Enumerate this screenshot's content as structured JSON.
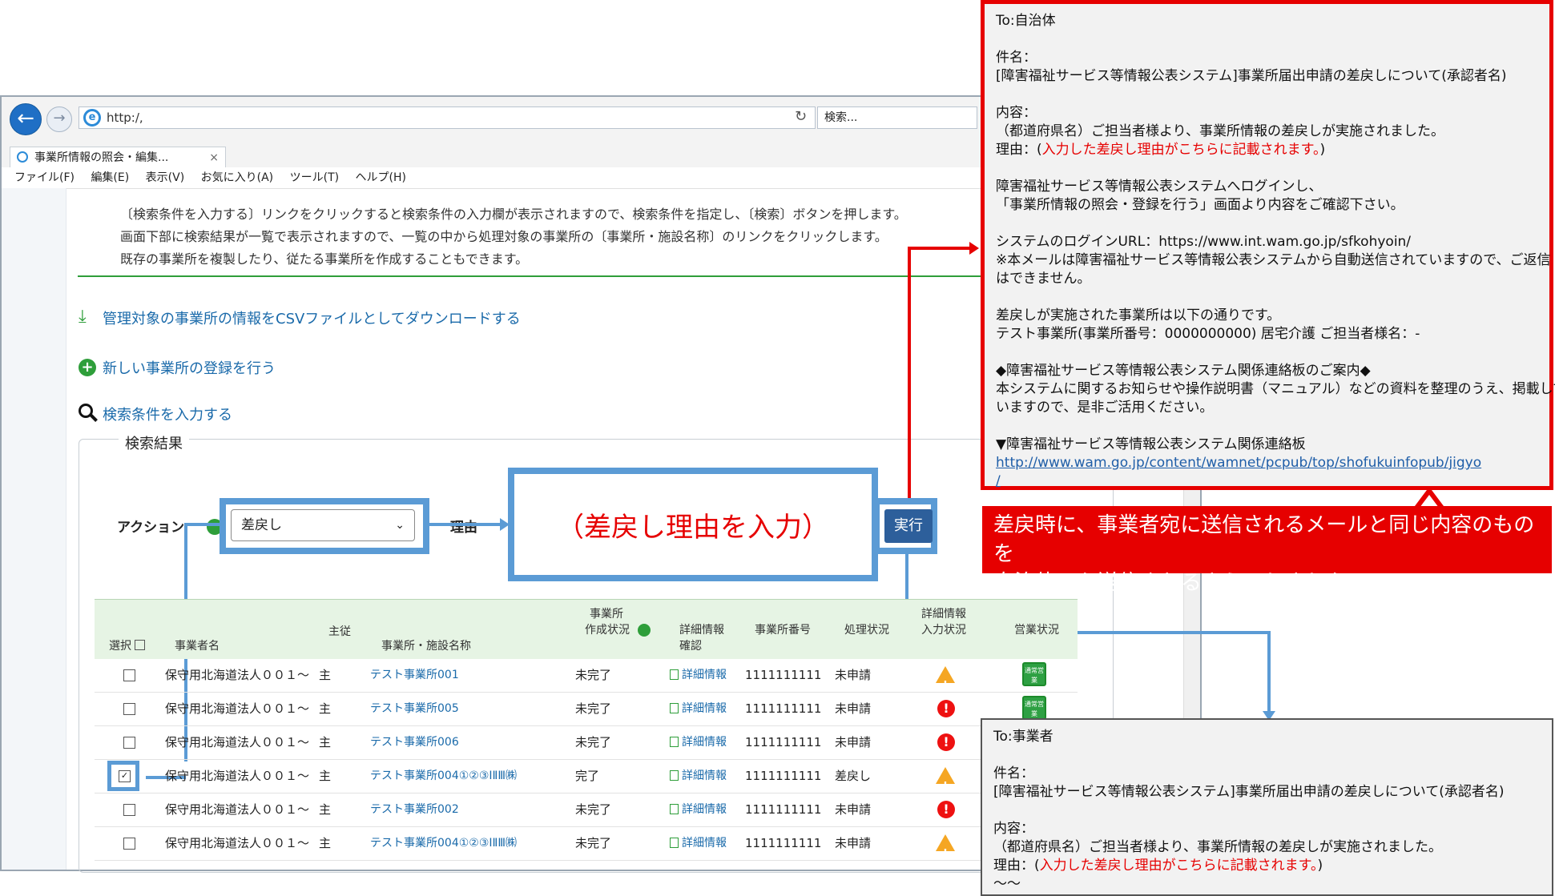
{
  "browser": {
    "url": "http:/,",
    "search_placeholder": "検索...",
    "tab_title": "事業所情報の照会・編集...",
    "tab_close": "×",
    "menu": [
      "ファイル(F)",
      "編集(E)",
      "表示(V)",
      "お気に入り(A)",
      "ツール(T)",
      "ヘルプ(H)"
    ]
  },
  "intro": [
    "〔検索条件を入力する〕リンクをクリックすると検索条件の入力欄が表示されますので、検索条件を指定し、〔検索〕ボタンを押します。",
    "画面下部に検索結果が一覧で表示されますので、一覧の中から処理対象の事業所の〔事業所・施設名称〕のリンクをクリックします。",
    "既存の事業所を複製したり、従たる事業所を作成することもできます。"
  ],
  "links": {
    "csv": "管理対象の事業所の情報をCSVファイルとしてダウンロードする",
    "new": "新しい事業所の登録を行う",
    "search": "検索条件を入力する"
  },
  "results": {
    "legend": "検索結果",
    "action_label": "アクション",
    "action_value": "差戻し",
    "reason_label": "理由",
    "reason_box": "（差戻し理由を入力）",
    "exec": "実行"
  },
  "table": {
    "headers": {
      "select": "選択",
      "name": "事業者名",
      "main": "主従",
      "facility": "事業所・施設名称",
      "create_status_1": "事業所",
      "create_status_2": "作成状況",
      "detail_1": "詳細情報",
      "detail_2": "確認",
      "number": "事業所番号",
      "process": "処理状況",
      "detail_input_1": "詳細情報",
      "detail_input_2": "入力状況",
      "business": "営業状況"
    },
    "rows": [
      {
        "checked": false,
        "name": "保守用北海道法人００１～",
        "main": "主",
        "facility": "テスト事業所001",
        "create": "未完了",
        "detail": "詳細情報",
        "number": "1111111111",
        "process": "未申請",
        "input_status": "warning",
        "business": "通常営業"
      },
      {
        "checked": false,
        "name": "保守用北海道法人００１～",
        "main": "主",
        "facility": "テスト事業所005",
        "create": "未完了",
        "detail": "詳細情報",
        "number": "1111111111",
        "process": "未申請",
        "input_status": "error",
        "business": "通常営業"
      },
      {
        "checked": false,
        "name": "保守用北海道法人００１～",
        "main": "主",
        "facility": "テスト事業所006",
        "create": "未完了",
        "detail": "詳細情報",
        "number": "1111111111",
        "process": "未申請",
        "input_status": "error",
        "business": ""
      },
      {
        "checked": true,
        "name": "保守用北海道法人００１～",
        "main": "主",
        "facility": "テスト事業所004①②③ⅠⅡⅢ㈱",
        "create": "完了",
        "detail": "詳細情報",
        "number": "1111111111",
        "process": "差戻し",
        "input_status": "warning",
        "business": ""
      },
      {
        "checked": false,
        "name": "保守用北海道法人００１～",
        "main": "主",
        "facility": "テスト事業所002",
        "create": "未完了",
        "detail": "詳細情報",
        "number": "1111111111",
        "process": "未申請",
        "input_status": "error",
        "business": ""
      },
      {
        "checked": false,
        "name": "保守用北海道法人００１～",
        "main": "主",
        "facility": "テスト事業所004①②③ⅠⅡⅢ㈱",
        "create": "未完了",
        "detail": "詳細情報",
        "number": "1111111111",
        "process": "未申請",
        "input_status": "warning",
        "business": ""
      }
    ]
  },
  "mail_top": {
    "to": "To:自治体",
    "subject_label": "件名：",
    "subject": "[障害福祉サービス等情報公表システム]事業所届出申請の差戻しについて(承認者名)",
    "body_label": "内容：",
    "body1": "（都道府県名）ご担当者様より、事業所情報の差戻しが実施されました。",
    "reason_prefix": "理由：(",
    "reason_text": "入力した差戻し理由がこちらに記載されます。",
    "reason_suffix": ")",
    "login1": "障害福祉サービス等情報公表システムへログインし、",
    "login2": "「事業所情報の照会・登録を行う」画面より内容をご確認下さい。",
    "url_line": "システムのログインURL：https://www.int.wam.go.jp/sfkohyoin/",
    "note1": "※本メールは障害福祉サービス等情報公表システムから自動送信されていますので、ご返信",
    "note2": "はできません。",
    "list1": "差戻しが実施された事業所は以下の通りです。",
    "list2": " テスト事業所(事業所番号：0000000000) 居宅介護 ご担当者様名：-",
    "info1": "◆障害福祉サービス等情報公表システム関係連絡板のご案内◆",
    "info2": "本システムに関するお知らせや操作説明書（マニュアル）などの資料を整理のうえ、掲載して",
    "info3": "いますので、是非ご活用ください。",
    "board": "▼障害福祉サービス等情報公表システム関係連絡板",
    "link1": "http://www.wam.go.jp/content/wamnet/pcpub/top/shofukuinfopub/jigyo",
    "link2": "/"
  },
  "callout": {
    "line1": "差戻時に、事業者宛に送信されるメールと同じ内容のものを",
    "line2": "自治体にも送信されるようにしました。"
  },
  "mail_bottom": {
    "to": "To:事業者",
    "subject_label": "件名：",
    "subject": "[障害福祉サービス等情報公表システム]事業所届出申請の差戻しについて(承認者名)",
    "body_label": "内容：",
    "body1": "（都道府県名）ご担当者様より、事業所情報の差戻しが実施されました。",
    "reason_prefix": "理由：(",
    "reason_text": "入力した差戻し理由がこちらに記載されます。",
    "reason_suffix": ")",
    "tail": "～～"
  },
  "colors": {
    "accent_red": "#e60000",
    "accent_blue": "#5b9bd5",
    "green": "#2e9e3a"
  }
}
